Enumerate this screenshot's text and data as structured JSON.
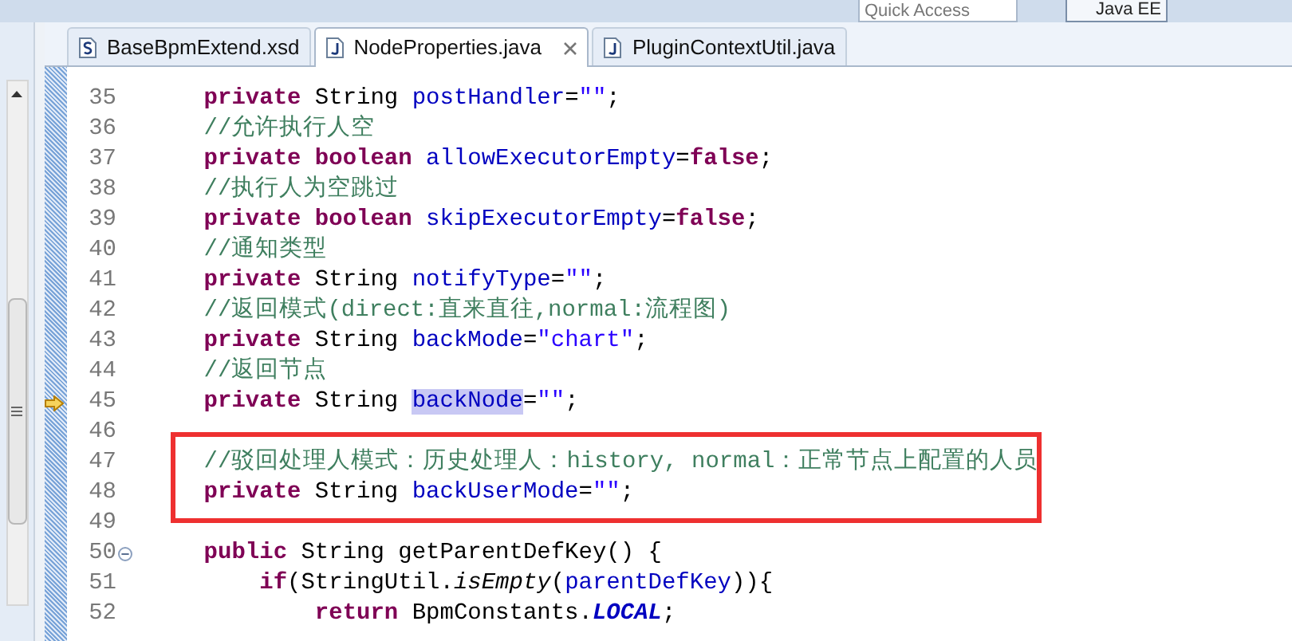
{
  "toolbar": {
    "quick_access": {
      "placeholder": "Quick Access"
    },
    "perspective": {
      "label": "Java EE",
      "selected": true
    }
  },
  "tabs": [
    {
      "label": "BaseBpmExtend.xsd",
      "kind": "schema",
      "selected": false
    },
    {
      "label": "NodeProperties.java",
      "kind": "java",
      "selected": true
    },
    {
      "label": "PluginContextUtil.java",
      "kind": "java",
      "selected": false
    }
  ],
  "lines": [
    {
      "number": "35",
      "tokens": [
        {
          "kind": "keyword",
          "text": "    private"
        },
        {
          "kind": "plain",
          "text": " String "
        },
        {
          "kind": "field",
          "text": "postHandler"
        },
        {
          "kind": "plain",
          "text": "="
        },
        {
          "kind": "string",
          "text": "\"\""
        },
        {
          "kind": "plain",
          "text": ";"
        }
      ]
    },
    {
      "number": "36",
      "tokens": [
        {
          "kind": "comment",
          "text": "    //允许执行人空"
        }
      ]
    },
    {
      "number": "37",
      "tokens": [
        {
          "kind": "keyword",
          "text": "    private boolean "
        },
        {
          "kind": "field",
          "text": "allowExecutorEmpty"
        },
        {
          "kind": "plain",
          "text": "="
        },
        {
          "kind": "keyword",
          "text": "false"
        },
        {
          "kind": "plain",
          "text": ";"
        }
      ]
    },
    {
      "number": "38",
      "tokens": [
        {
          "kind": "comment",
          "text": "    //执行人为空跳过"
        }
      ]
    },
    {
      "number": "39",
      "tokens": [
        {
          "kind": "keyword",
          "text": "    private boolean "
        },
        {
          "kind": "field",
          "text": "skipExecutorEmpty"
        },
        {
          "kind": "plain",
          "text": "="
        },
        {
          "kind": "keyword",
          "text": "false"
        },
        {
          "kind": "plain",
          "text": ";"
        }
      ]
    },
    {
      "number": "40",
      "tokens": [
        {
          "kind": "comment",
          "text": "    //通知类型"
        }
      ]
    },
    {
      "number": "41",
      "tokens": [
        {
          "kind": "keyword",
          "text": "    private"
        },
        {
          "kind": "plain",
          "text": " String "
        },
        {
          "kind": "field",
          "text": "notifyType"
        },
        {
          "kind": "plain",
          "text": "="
        },
        {
          "kind": "string",
          "text": "\"\""
        },
        {
          "kind": "plain",
          "text": ";"
        }
      ]
    },
    {
      "number": "42",
      "tokens": [
        {
          "kind": "comment",
          "text": "    //返回模式(direct:直来直往,normal:流程图)"
        }
      ]
    },
    {
      "number": "43",
      "tokens": [
        {
          "kind": "keyword",
          "text": "    private"
        },
        {
          "kind": "plain",
          "text": " String "
        },
        {
          "kind": "field",
          "text": "backMode"
        },
        {
          "kind": "plain",
          "text": "="
        },
        {
          "kind": "string",
          "text": "\"chart\""
        },
        {
          "kind": "plain",
          "text": ";"
        }
      ]
    },
    {
      "number": "44",
      "tokens": [
        {
          "kind": "comment",
          "text": "    //返回节点"
        }
      ]
    },
    {
      "number": "45",
      "bookmarked": true,
      "tokens": [
        {
          "kind": "keyword",
          "text": "    private"
        },
        {
          "kind": "plain",
          "text": " String "
        },
        {
          "kind": "field",
          "text": "backNode",
          "highlighted": true
        },
        {
          "kind": "plain",
          "text": "="
        },
        {
          "kind": "string",
          "text": "\"\""
        },
        {
          "kind": "plain",
          "text": ";"
        }
      ]
    },
    {
      "number": "46"
    },
    {
      "number": "47",
      "boxed": true,
      "tokens": [
        {
          "kind": "comment",
          "text": "    //驳回处理人模式：历史处理人：history, normal：正常节点上配置的人员"
        }
      ]
    },
    {
      "number": "48",
      "boxed": true,
      "tokens": [
        {
          "kind": "keyword",
          "text": "    private"
        },
        {
          "kind": "plain",
          "text": " String "
        },
        {
          "kind": "field",
          "text": "backUserMode"
        },
        {
          "kind": "plain",
          "text": "="
        },
        {
          "kind": "string",
          "text": "\"\""
        },
        {
          "kind": "plain",
          "text": ";"
        }
      ]
    },
    {
      "number": "49"
    },
    {
      "number": "50",
      "foldable": true,
      "tokens": [
        {
          "kind": "keyword",
          "text": "    public"
        },
        {
          "kind": "plain",
          "text": " String getParentDefKey() {"
        }
      ]
    },
    {
      "number": "51",
      "tokens": [
        {
          "kind": "keyword",
          "text": "        if"
        },
        {
          "kind": "plain",
          "text": "(StringUtil."
        },
        {
          "kind": "method_static",
          "text": "isEmpty"
        },
        {
          "kind": "plain",
          "text": "("
        },
        {
          "kind": "field",
          "text": "parentDefKey"
        },
        {
          "kind": "plain",
          "text": ")){"
        }
      ]
    },
    {
      "number": "52",
      "tokens": [
        {
          "kind": "keyword",
          "text": "            return"
        },
        {
          "kind": "plain",
          "text": " BpmConstants."
        },
        {
          "kind": "constant",
          "text": "LOCAL"
        },
        {
          "kind": "plain",
          "text": ";"
        }
      ]
    }
  ]
}
